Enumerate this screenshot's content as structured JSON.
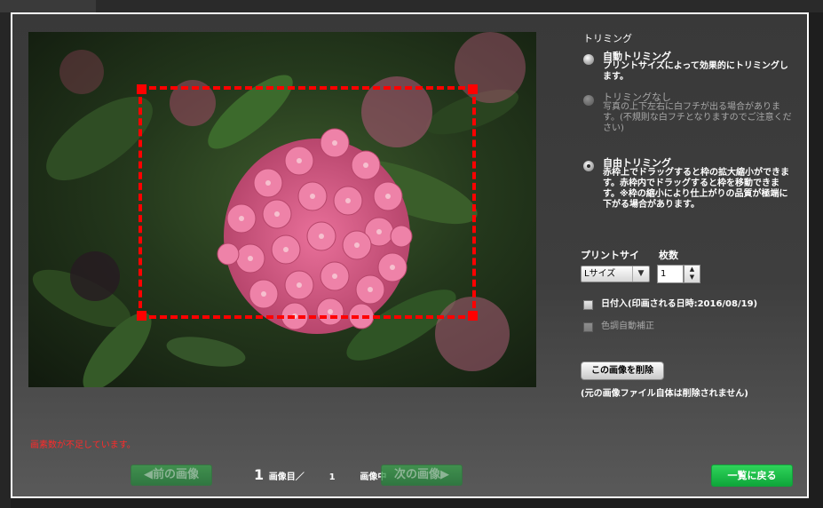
{
  "trimming": {
    "title": "トリミング",
    "auto": {
      "label": "自動トリミング",
      "desc": "プリントサイズによって効果的にトリミングします。"
    },
    "none": {
      "label": "トリミングなし",
      "desc": "写真の上下左右に白フチが出る場合があります。(不規則な白フチとなりますのでご注意ください)"
    },
    "free": {
      "label": "自由トリミング",
      "desc": "赤枠上でドラッグすると枠の拡大縮小ができます。赤枠内でドラッグすると枠を移動できます。※枠の縮小により仕上がりの品質が極端に下がる場合があります。"
    },
    "selected": "free"
  },
  "print": {
    "size_label": "プリントサイ",
    "count_label": "枚数",
    "size_value": "Lサイズ",
    "count_value": "1"
  },
  "date_stamp": {
    "label": "日付入(印画される日時:2016/08/19)"
  },
  "color_correction": {
    "label": "色調自動補正"
  },
  "delete": {
    "button": "この画像を削除",
    "note": "(元の画像ファイル自体は削除されません)"
  },
  "warning": "画素数が不足しています。",
  "nav": {
    "prev": "◀前の画像",
    "next": "次の画像▶",
    "current": "1",
    "current_suffix": "画像目／",
    "total": "1",
    "total_suffix": "画像中"
  },
  "back_button": "一覧に戻る",
  "colors": {
    "trim_frame": "#ff0000",
    "warning": "#ff2a2a",
    "back_button": "#0ea63a"
  }
}
